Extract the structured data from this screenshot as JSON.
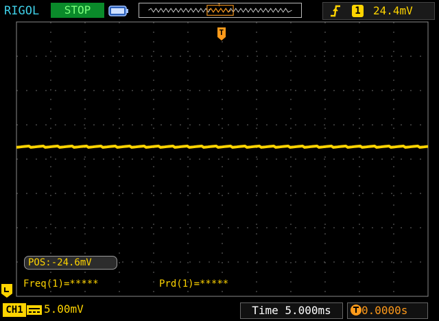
{
  "header": {
    "brand": "RIGOL",
    "run_state": "STOP",
    "trigger": {
      "edge": "rising-edge-icon",
      "channel": "1",
      "level": "24.4mV"
    }
  },
  "screen": {
    "position_label": "POS:-24.6mV",
    "measurements": {
      "freq": "Freq(1)=*****",
      "period": "Prd(1)=*****"
    },
    "trigger_marker": "T"
  },
  "footer": {
    "channel_label": "CH1",
    "coupling_icon": "dc-coupling-icon",
    "volts_per_div": "5.00mV",
    "timebase": "Time 5.000ms",
    "trigger_offset": "0.0000s"
  },
  "colors": {
    "trace": "#ffd400",
    "brand": "#3fd0e8",
    "run_state_bg": "#0a8a2a",
    "trigger": "#ff9a1a",
    "grid": "#7a7a7a"
  }
}
